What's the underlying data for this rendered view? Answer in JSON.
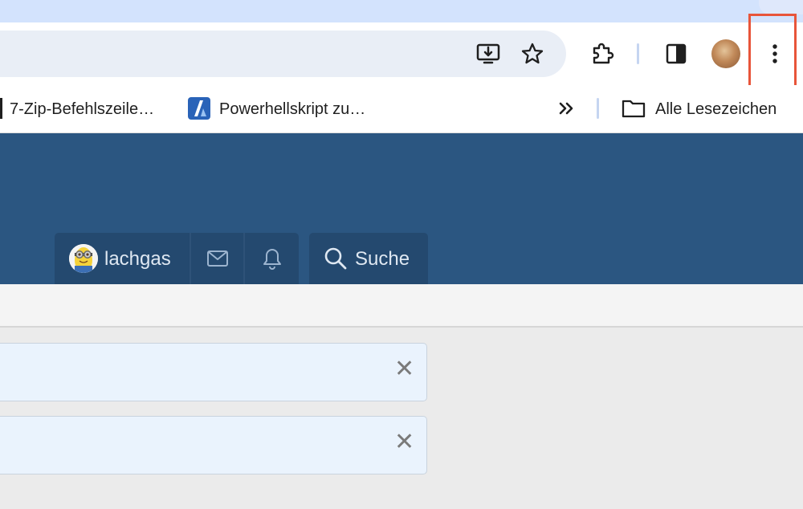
{
  "bookmarks": {
    "items": [
      {
        "label": "7-Zip-Befehlszeile…",
        "icon": "bookmark-page-icon"
      },
      {
        "label": "Powerhellskript zu…",
        "icon": "powershell-logo-icon"
      }
    ],
    "overflow_icon": "double-chevron-right-icon",
    "all_bookmarks_label": "Alle Lesezeichen"
  },
  "forum_nav": {
    "username": "lachgas",
    "search_label": "Suche"
  },
  "notices": [
    {
      "close_label": "✕"
    },
    {
      "close_label": "✕"
    }
  ],
  "colors": {
    "tabstrip": "#d3e3fd",
    "omnibox": "#e9eef6",
    "site_header": "#2b5681",
    "nav_button": "#24496f",
    "highlight_box": "#e8553a",
    "notice_background": "#eaf3fd"
  }
}
